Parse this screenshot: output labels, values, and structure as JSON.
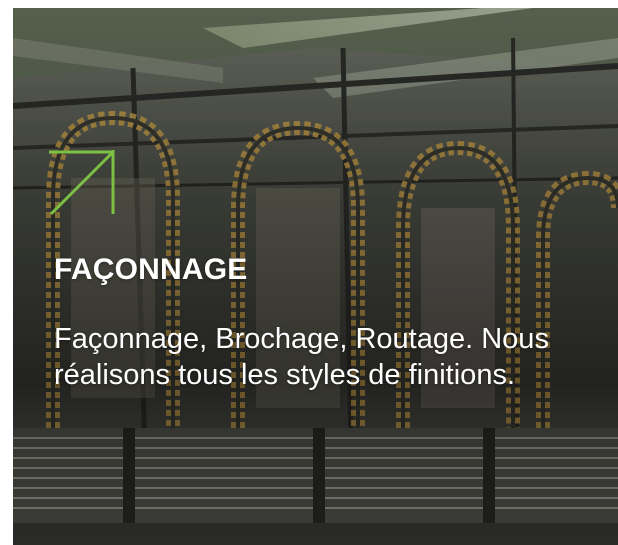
{
  "card": {
    "title": "FAÇONNAGE",
    "description": "Façonnage, Brochage, Routage. Nous réalisons tous les styles de finitions.",
    "icon": "arrow-up-right-icon",
    "accent_color": "#7cc142",
    "text_color": "#ffffff"
  }
}
